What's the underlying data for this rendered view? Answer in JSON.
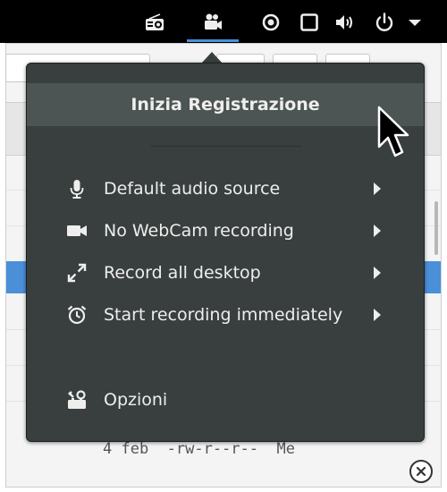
{
  "topbar": {
    "icons": [
      "radio-icon",
      "video-camera-icon",
      "location-icon",
      "window-icon",
      "volume-icon",
      "power-icon",
      "dropdown-arrow-icon"
    ]
  },
  "menu": {
    "title": "Inizia Registrazione",
    "items": [
      {
        "icon": "microphone-icon",
        "label": "Default audio source",
        "submenu": true
      },
      {
        "icon": "webcam-icon",
        "label": "No WebCam recording",
        "submenu": true
      },
      {
        "icon": "fullscreen-icon",
        "label": "Record all desktop",
        "submenu": true
      },
      {
        "icon": "alarm-clock-icon",
        "label": "Start recording immediately",
        "submenu": true
      }
    ],
    "options_label": "Opzioni"
  },
  "background": {
    "file_row_text": "4 feb  -rw-r--r--  Me"
  },
  "colors": {
    "menu_bg": "#393f3f",
    "menu_title_bg": "#4c5454",
    "accent": "#4a90d9",
    "topbar_bg": "#000000"
  }
}
